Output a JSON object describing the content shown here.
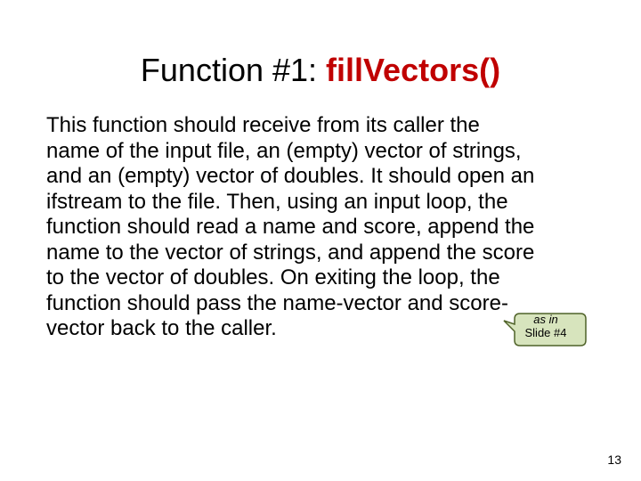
{
  "title": {
    "prefix": "Function #1: ",
    "name": "fillVectors()"
  },
  "body": "This function should receive from its caller the name of the input file, an (empty) vector of strings, and an (empty) vector of doubles. It should open an ifstream to the file.  Then, using an input loop, the function should read a name and score, append the name to the vector of strings, and append the score to the vector of doubles. On exiting the loop, the function should pass the name-vector and score-vector back to the caller.",
  "callout": {
    "line1": "as in",
    "line2": "Slide #4"
  },
  "page_number": "13"
}
